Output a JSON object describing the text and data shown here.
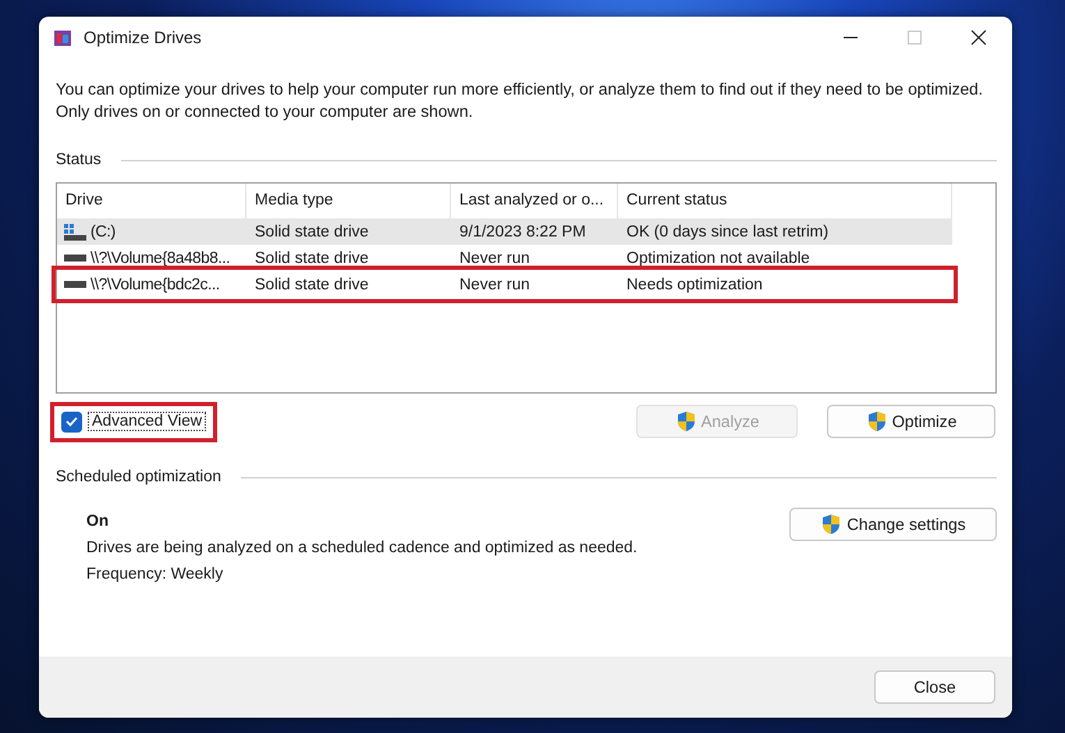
{
  "window": {
    "title": "Optimize Drives"
  },
  "description": "You can optimize your drives to help your computer run more efficiently, or analyze them to find out if they need to be optimized. Only drives on or connected to your computer are shown.",
  "status": {
    "heading": "Status",
    "table": {
      "columns": [
        "Drive",
        "Media type",
        "Last analyzed or o...",
        "Current status"
      ],
      "rows": [
        {
          "kind": "system",
          "drive": "(C:)",
          "media": "Solid state drive",
          "last": "9/1/2023 8:22 PM",
          "status": "OK (0 days since last retrim)",
          "selected": true,
          "highlighted": false
        },
        {
          "kind": "volume",
          "drive": "\\\\?\\Volume{8a48b8...",
          "media": "Solid state drive",
          "last": "Never run",
          "status": "Optimization not available",
          "selected": false,
          "highlighted": false
        },
        {
          "kind": "volume",
          "drive": "\\\\?\\Volume{bdc2c...",
          "media": "Solid state drive",
          "last": "Never run",
          "status": "Needs optimization",
          "selected": false,
          "highlighted": true
        }
      ]
    }
  },
  "advanced_view": {
    "label": "Advanced View",
    "checked": true,
    "highlighted": true
  },
  "buttons": [
    {
      "label": "Analyze",
      "disabled": true
    },
    {
      "label": "Optimize",
      "disabled": false
    }
  ],
  "scheduled": {
    "heading": "Scheduled optimization",
    "state": "On",
    "detail": "Drives are being analyzed on a scheduled cadence and optimized as needed.",
    "frequency": "Frequency: Weekly",
    "button": "Change settings"
  },
  "close_button": "Close"
}
